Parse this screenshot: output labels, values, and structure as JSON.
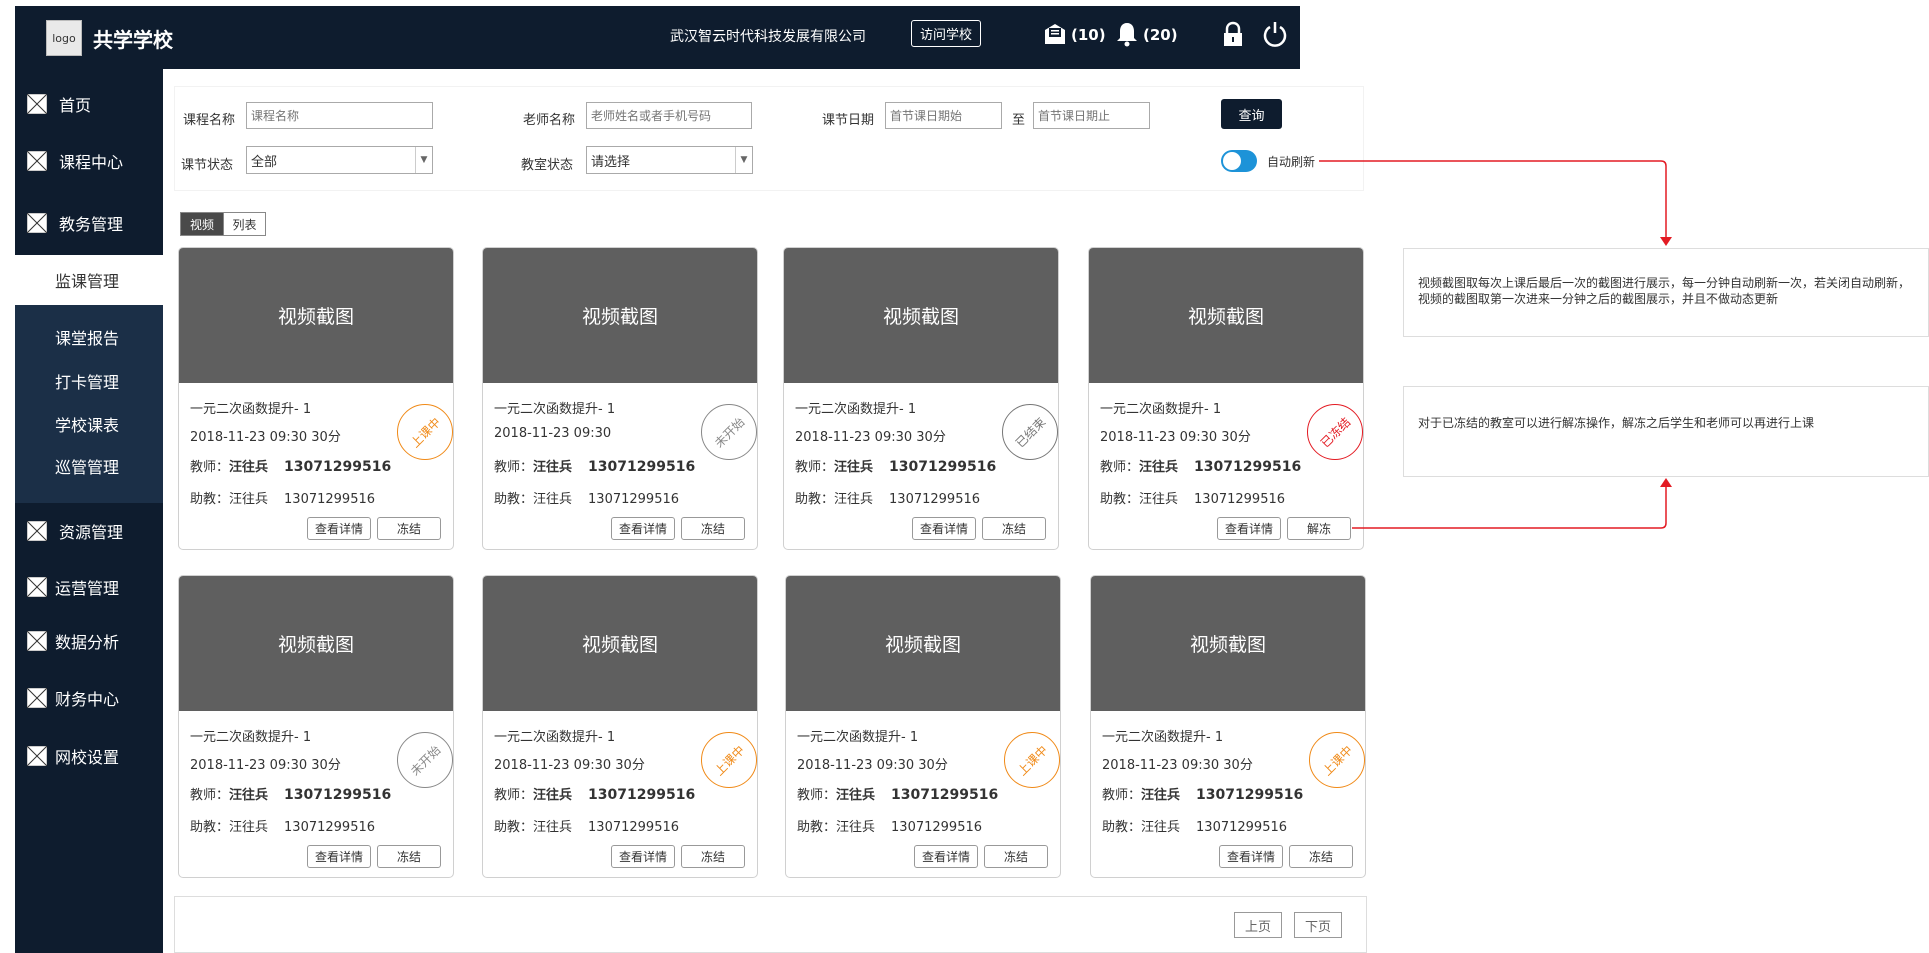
{
  "header": {
    "logo_text": "logo",
    "app_title": "共学学校",
    "company": "武汉智云时代科技发展有限公司",
    "visit_button": "访问学校",
    "messages_count": "(10)",
    "notifications_count": "(20)"
  },
  "sidebar": {
    "items": [
      {
        "label": "首页"
      },
      {
        "label": "课程中心"
      },
      {
        "label": "教务管理"
      },
      {
        "label": "监课管理"
      },
      {
        "label": "资源管理"
      },
      {
        "label": "运营管理"
      },
      {
        "label": "数据分析"
      },
      {
        "label": "财务中心"
      },
      {
        "label": "网校设置"
      }
    ],
    "sub_items": [
      {
        "label": "课堂报告"
      },
      {
        "label": "打卡管理"
      },
      {
        "label": "学校课表"
      },
      {
        "label": "巡管管理"
      }
    ]
  },
  "filter": {
    "course_name_label": "课程名称",
    "course_name_placeholder": "课程名称",
    "teacher_label": "老师名称",
    "teacher_placeholder": "老师姓名或者手机号码",
    "date_label": "课节日期",
    "date_start_placeholder": "首节课日期始",
    "date_to": "至",
    "date_end_placeholder": "首节课日期止",
    "query_button": "查询",
    "status_label": "课节状态",
    "status_value": "全部",
    "room_label": "教室状态",
    "room_value": "请选择",
    "auto_refresh_label": "自动刷新"
  },
  "view_tabs": {
    "video": "视频",
    "list": "列表"
  },
  "cards": [
    {
      "thumb": "视频截图",
      "title": "一元二次函数提升- 1",
      "time": "2018-11-23 09:30  30分",
      "teacher_prefix": "教师：",
      "teacher": "汪往兵",
      "teacher_phone": "13071299516",
      "assistant_prefix": "助教：",
      "assistant": "汪往兵",
      "assistant_phone": "13071299516",
      "status": "上课中",
      "status_kind": "on",
      "btn_detail": "查看详情",
      "btn_action": "冻结"
    },
    {
      "thumb": "视频截图",
      "title": "一元二次函数提升- 1",
      "time": "2018-11-23 09:30",
      "teacher_prefix": "教师：",
      "teacher": "汪往兵",
      "teacher_phone": "13071299516",
      "assistant_prefix": "助教：",
      "assistant": "汪往兵",
      "assistant_phone": "13071299516",
      "status": "未开始",
      "status_kind": "pend",
      "btn_detail": "查看详情",
      "btn_action": "冻结"
    },
    {
      "thumb": "视频截图",
      "title": "一元二次函数提升- 1",
      "time": "2018-11-23 09:30  30分",
      "teacher_prefix": "教师：",
      "teacher": "汪往兵",
      "teacher_phone": "13071299516",
      "assistant_prefix": "助教：",
      "assistant": "汪往兵",
      "assistant_phone": "13071299516",
      "status": "已结束",
      "status_kind": "done",
      "btn_detail": "查看详情",
      "btn_action": "冻结"
    },
    {
      "thumb": "视频截图",
      "title": "一元二次函数提升- 1",
      "time": "2018-11-23 09:30  30分",
      "teacher_prefix": "教师：",
      "teacher": "汪往兵",
      "teacher_phone": "13071299516",
      "assistant_prefix": "助教：",
      "assistant": "汪往兵",
      "assistant_phone": "13071299516",
      "status": "已冻结",
      "status_kind": "frozen",
      "btn_detail": "查看详情",
      "btn_action": "解冻"
    },
    {
      "thumb": "视频截图",
      "title": "一元二次函数提升- 1",
      "time": "2018-11-23 09:30  30分",
      "teacher_prefix": "教师：",
      "teacher": "汪往兵",
      "teacher_phone": "13071299516",
      "assistant_prefix": "助教：",
      "assistant": "汪往兵",
      "assistant_phone": "13071299516",
      "status": "未开始",
      "status_kind": "pend",
      "btn_detail": "查看详情",
      "btn_action": "冻结"
    },
    {
      "thumb": "视频截图",
      "title": "一元二次函数提升- 1",
      "time": "2018-11-23 09:30  30分",
      "teacher_prefix": "教师：",
      "teacher": "汪往兵",
      "teacher_phone": "13071299516",
      "assistant_prefix": "助教：",
      "assistant": "汪往兵",
      "assistant_phone": "13071299516",
      "status": "上课中",
      "status_kind": "on",
      "btn_detail": "查看详情",
      "btn_action": "冻结"
    },
    {
      "thumb": "视频截图",
      "title": "一元二次函数提升- 1",
      "time": "2018-11-23 09:30  30分",
      "teacher_prefix": "教师：",
      "teacher": "汪往兵",
      "teacher_phone": "13071299516",
      "assistant_prefix": "助教：",
      "assistant": "汪往兵",
      "assistant_phone": "13071299516",
      "status": "上课中",
      "status_kind": "on",
      "btn_detail": "查看详情",
      "btn_action": "冻结"
    },
    {
      "thumb": "视频截图",
      "title": "一元二次函数提升- 1",
      "time": "2018-11-23 09:30  30分",
      "teacher_prefix": "教师：",
      "teacher": "汪往兵",
      "teacher_phone": "13071299516",
      "assistant_prefix": "助教：",
      "assistant": "汪往兵",
      "assistant_phone": "13071299516",
      "status": "上课中",
      "status_kind": "on",
      "btn_detail": "查看详情",
      "btn_action": "冻结"
    }
  ],
  "pager": {
    "prev": "上页",
    "next": "下页"
  },
  "notes": {
    "refresh_note": "视频截图取每次上课后最后一次的截图进行展示，每一分钟自动刷新一次，若关闭自动刷新，视频的截图取第一次进来一分钟之后的截图展示，并且不做动态更新",
    "freeze_note": "对于已冻结的教室可以进行解冻操作，解冻之后学生和老师可以再进行上课"
  },
  "colors": {
    "header_bg": "#0e1c2e",
    "sub_nav_bg": "#1b2f47",
    "toggle_on": "#1d93d8",
    "status_on": "#f08a18",
    "status_frozen": "#e31b23",
    "connector": "#e31b23"
  }
}
